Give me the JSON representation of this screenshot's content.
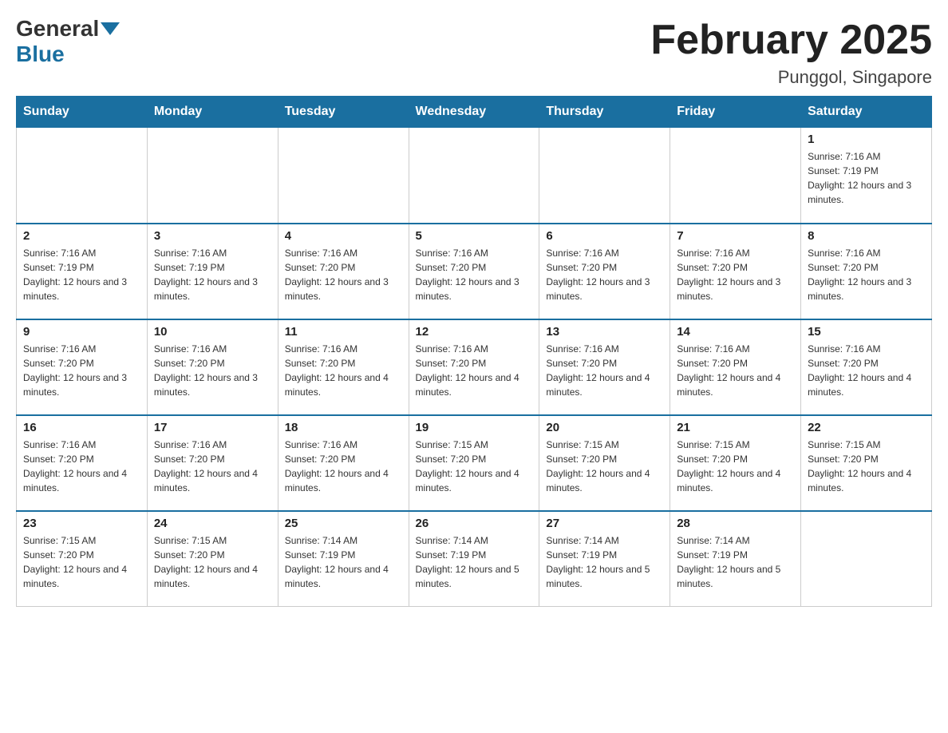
{
  "header": {
    "logo_general": "General",
    "logo_blue": "Blue",
    "month_title": "February 2025",
    "location": "Punggol, Singapore"
  },
  "weekdays": [
    "Sunday",
    "Monday",
    "Tuesday",
    "Wednesday",
    "Thursday",
    "Friday",
    "Saturday"
  ],
  "weeks": [
    [
      {
        "day": "",
        "sunrise": "",
        "sunset": "",
        "daylight": ""
      },
      {
        "day": "",
        "sunrise": "",
        "sunset": "",
        "daylight": ""
      },
      {
        "day": "",
        "sunrise": "",
        "sunset": "",
        "daylight": ""
      },
      {
        "day": "",
        "sunrise": "",
        "sunset": "",
        "daylight": ""
      },
      {
        "day": "",
        "sunrise": "",
        "sunset": "",
        "daylight": ""
      },
      {
        "day": "",
        "sunrise": "",
        "sunset": "",
        "daylight": ""
      },
      {
        "day": "1",
        "sunrise": "Sunrise: 7:16 AM",
        "sunset": "Sunset: 7:19 PM",
        "daylight": "Daylight: 12 hours and 3 minutes."
      }
    ],
    [
      {
        "day": "2",
        "sunrise": "Sunrise: 7:16 AM",
        "sunset": "Sunset: 7:19 PM",
        "daylight": "Daylight: 12 hours and 3 minutes."
      },
      {
        "day": "3",
        "sunrise": "Sunrise: 7:16 AM",
        "sunset": "Sunset: 7:19 PM",
        "daylight": "Daylight: 12 hours and 3 minutes."
      },
      {
        "day": "4",
        "sunrise": "Sunrise: 7:16 AM",
        "sunset": "Sunset: 7:20 PM",
        "daylight": "Daylight: 12 hours and 3 minutes."
      },
      {
        "day": "5",
        "sunrise": "Sunrise: 7:16 AM",
        "sunset": "Sunset: 7:20 PM",
        "daylight": "Daylight: 12 hours and 3 minutes."
      },
      {
        "day": "6",
        "sunrise": "Sunrise: 7:16 AM",
        "sunset": "Sunset: 7:20 PM",
        "daylight": "Daylight: 12 hours and 3 minutes."
      },
      {
        "day": "7",
        "sunrise": "Sunrise: 7:16 AM",
        "sunset": "Sunset: 7:20 PM",
        "daylight": "Daylight: 12 hours and 3 minutes."
      },
      {
        "day": "8",
        "sunrise": "Sunrise: 7:16 AM",
        "sunset": "Sunset: 7:20 PM",
        "daylight": "Daylight: 12 hours and 3 minutes."
      }
    ],
    [
      {
        "day": "9",
        "sunrise": "Sunrise: 7:16 AM",
        "sunset": "Sunset: 7:20 PM",
        "daylight": "Daylight: 12 hours and 3 minutes."
      },
      {
        "day": "10",
        "sunrise": "Sunrise: 7:16 AM",
        "sunset": "Sunset: 7:20 PM",
        "daylight": "Daylight: 12 hours and 3 minutes."
      },
      {
        "day": "11",
        "sunrise": "Sunrise: 7:16 AM",
        "sunset": "Sunset: 7:20 PM",
        "daylight": "Daylight: 12 hours and 4 minutes."
      },
      {
        "day": "12",
        "sunrise": "Sunrise: 7:16 AM",
        "sunset": "Sunset: 7:20 PM",
        "daylight": "Daylight: 12 hours and 4 minutes."
      },
      {
        "day": "13",
        "sunrise": "Sunrise: 7:16 AM",
        "sunset": "Sunset: 7:20 PM",
        "daylight": "Daylight: 12 hours and 4 minutes."
      },
      {
        "day": "14",
        "sunrise": "Sunrise: 7:16 AM",
        "sunset": "Sunset: 7:20 PM",
        "daylight": "Daylight: 12 hours and 4 minutes."
      },
      {
        "day": "15",
        "sunrise": "Sunrise: 7:16 AM",
        "sunset": "Sunset: 7:20 PM",
        "daylight": "Daylight: 12 hours and 4 minutes."
      }
    ],
    [
      {
        "day": "16",
        "sunrise": "Sunrise: 7:16 AM",
        "sunset": "Sunset: 7:20 PM",
        "daylight": "Daylight: 12 hours and 4 minutes."
      },
      {
        "day": "17",
        "sunrise": "Sunrise: 7:16 AM",
        "sunset": "Sunset: 7:20 PM",
        "daylight": "Daylight: 12 hours and 4 minutes."
      },
      {
        "day": "18",
        "sunrise": "Sunrise: 7:16 AM",
        "sunset": "Sunset: 7:20 PM",
        "daylight": "Daylight: 12 hours and 4 minutes."
      },
      {
        "day": "19",
        "sunrise": "Sunrise: 7:15 AM",
        "sunset": "Sunset: 7:20 PM",
        "daylight": "Daylight: 12 hours and 4 minutes."
      },
      {
        "day": "20",
        "sunrise": "Sunrise: 7:15 AM",
        "sunset": "Sunset: 7:20 PM",
        "daylight": "Daylight: 12 hours and 4 minutes."
      },
      {
        "day": "21",
        "sunrise": "Sunrise: 7:15 AM",
        "sunset": "Sunset: 7:20 PM",
        "daylight": "Daylight: 12 hours and 4 minutes."
      },
      {
        "day": "22",
        "sunrise": "Sunrise: 7:15 AM",
        "sunset": "Sunset: 7:20 PM",
        "daylight": "Daylight: 12 hours and 4 minutes."
      }
    ],
    [
      {
        "day": "23",
        "sunrise": "Sunrise: 7:15 AM",
        "sunset": "Sunset: 7:20 PM",
        "daylight": "Daylight: 12 hours and 4 minutes."
      },
      {
        "day": "24",
        "sunrise": "Sunrise: 7:15 AM",
        "sunset": "Sunset: 7:20 PM",
        "daylight": "Daylight: 12 hours and 4 minutes."
      },
      {
        "day": "25",
        "sunrise": "Sunrise: 7:14 AM",
        "sunset": "Sunset: 7:19 PM",
        "daylight": "Daylight: 12 hours and 4 minutes."
      },
      {
        "day": "26",
        "sunrise": "Sunrise: 7:14 AM",
        "sunset": "Sunset: 7:19 PM",
        "daylight": "Daylight: 12 hours and 5 minutes."
      },
      {
        "day": "27",
        "sunrise": "Sunrise: 7:14 AM",
        "sunset": "Sunset: 7:19 PM",
        "daylight": "Daylight: 12 hours and 5 minutes."
      },
      {
        "day": "28",
        "sunrise": "Sunrise: 7:14 AM",
        "sunset": "Sunset: 7:19 PM",
        "daylight": "Daylight: 12 hours and 5 minutes."
      },
      {
        "day": "",
        "sunrise": "",
        "sunset": "",
        "daylight": ""
      }
    ]
  ]
}
